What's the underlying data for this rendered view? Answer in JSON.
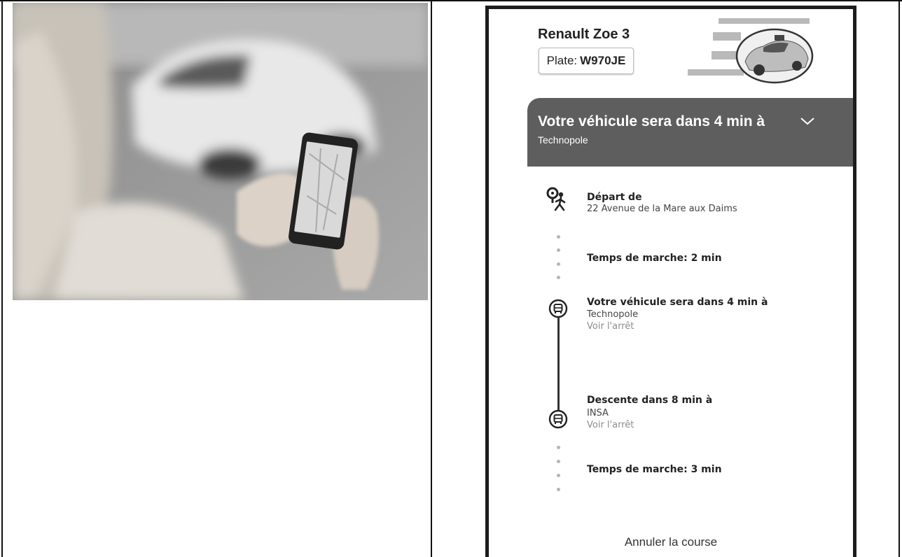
{
  "vehicle": {
    "model": "Renault Zoe 3",
    "plate_label": "Plate:",
    "plate_number": "W970JE"
  },
  "banner": {
    "title": "Votre véhicule sera dans 4 min à",
    "subtitle": "Technopole"
  },
  "steps": [
    {
      "icon": "walking-person-pin-icon",
      "title": "Départ de",
      "text": "22 Avenue de la Mare aux Daims"
    },
    {
      "icon": "dotted-walk-connector",
      "title": "Temps de marche: 2 min"
    },
    {
      "icon": "bus-stop-icon",
      "title": "Votre véhicule sera dans 4 min à",
      "text": "Technopole",
      "link": "Voir l'arrêt"
    },
    {
      "icon": "bus-stop-icon",
      "title": "Descente dans 8 min à",
      "text": "INSA",
      "link": "Voir l'arrêt"
    },
    {
      "icon": "dotted-walk-connector",
      "title": "Temps de marche: 3 min"
    }
  ],
  "actions": {
    "cancel_label": "Annuler la course"
  },
  "colors": {
    "banner_bg": "#5e5e5e",
    "link_gray": "#8c8c8c",
    "frame": "#1c1c1c"
  }
}
